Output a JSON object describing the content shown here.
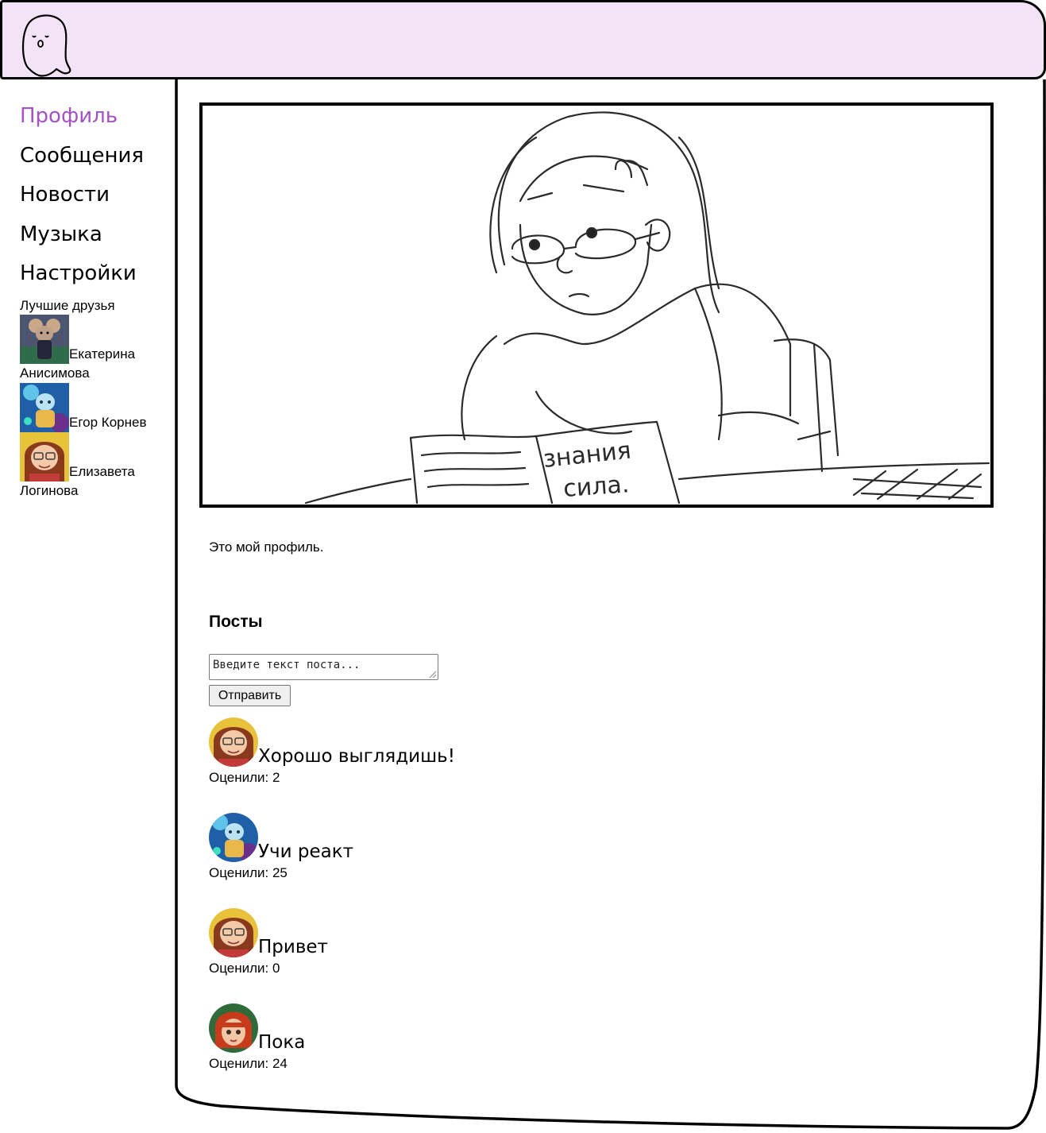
{
  "header": {
    "logo_icon": "ghost-icon"
  },
  "nav": {
    "items": [
      {
        "label": "Профиль",
        "active": true
      },
      {
        "label": "Сообщения",
        "active": false
      },
      {
        "label": "Новости",
        "active": false
      },
      {
        "label": "Музыка",
        "active": false
      },
      {
        "label": "Настройки",
        "active": false
      }
    ],
    "active_color": "#a453c2"
  },
  "friends": {
    "title": "Лучшие друзья",
    "items": [
      {
        "name": "Екатерина Анисимова",
        "avatar": "mouse-character-avatar"
      },
      {
        "name": "Егор Корнев",
        "avatar": "blue-fantasy-avatar"
      },
      {
        "name": "Елизавета Логинова",
        "avatar": "cartoon-girl-avatar"
      }
    ]
  },
  "profile": {
    "cover": "sketch-girl-reading-book-image",
    "cover_book_text": [
      "знания",
      "сила."
    ],
    "about": "Это мой профиль."
  },
  "posts": {
    "title": "Посты",
    "placeholder": "Введите текст поста...",
    "send_label": "Отправить",
    "items": [
      {
        "text": "Хорошо выглядишь!",
        "likes": "Оценили: 2",
        "avatar": "cartoon-girl-avatar"
      },
      {
        "text": "Учи реакт",
        "likes": "Оценили: 25",
        "avatar": "blue-fantasy-avatar"
      },
      {
        "text": "Привет",
        "likes": "Оценили: 0",
        "avatar": "cartoon-girl-avatar"
      },
      {
        "text": "Пока",
        "likes": "Оценили: 24",
        "avatar": "red-hair-girl-avatar"
      }
    ]
  },
  "colors": {
    "header_bg": "#f2e4f6",
    "accent": "#a453c2"
  }
}
